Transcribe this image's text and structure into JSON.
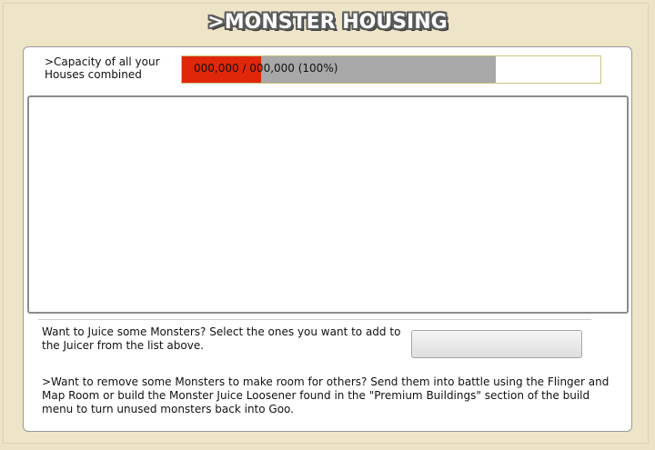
{
  "header": {
    "title": ">MONSTER HOUSING"
  },
  "capacity": {
    "label": ">Capacity of all your Houses combined",
    "value_text": "000,000 / 000,000 (100%)",
    "red_fill_fraction": 0.19,
    "gray_fill_fraction": 0.75,
    "colors": {
      "red": "#e0270a",
      "gray": "#a8a8a8"
    }
  },
  "monster_list": {
    "items": []
  },
  "juicer": {
    "text": "Want to Juice some Monsters? Select the ones you want to add to the Juicer from the list above.",
    "button_label": ""
  },
  "remove_info": {
    "text": ">Want to remove some Monsters to make room for others? Send them into battle using the Flinger and Map Room or build the Monster Juice Loosener found in the \"Premium Buildings\" section of the build menu to turn unused monsters back into Goo."
  }
}
